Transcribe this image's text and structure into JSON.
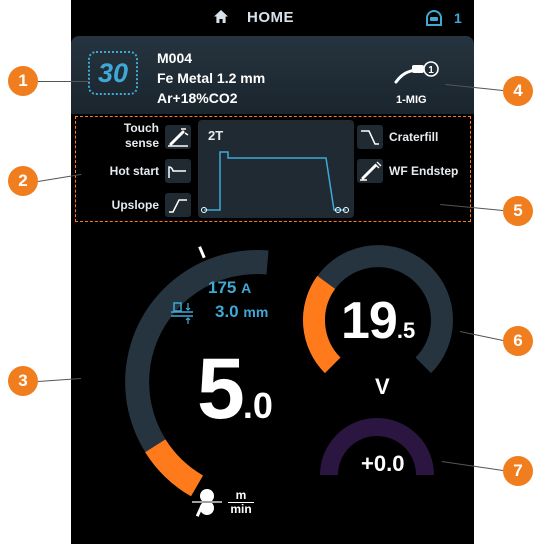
{
  "header": {
    "title": "HOME",
    "user_count": "1"
  },
  "program": {
    "memory_number": "30",
    "name": "M004",
    "wire": "Fe Metal 1.2 mm",
    "gas": "Ar+18%CO2",
    "process_label": "1-MIG",
    "process_icon_number": "1"
  },
  "settings": {
    "touch_sense": "Touch sense",
    "touch_sense_line1": "Touch",
    "touch_sense_line2": "sense",
    "hot_start": "Hot start",
    "upslope": "Upslope",
    "trigger_mode": "2T",
    "craterfill": "Craterfill",
    "wf_endstep": "WF Endstep"
  },
  "wire_feed": {
    "value_main": "5",
    "value_decimal": ".0",
    "level_fraction": 0.18,
    "unit_top": "m",
    "unit_bottom": "min",
    "current_value": "175",
    "current_unit": "A",
    "thickness_value": "3.0",
    "thickness_unit": "mm"
  },
  "voltage": {
    "value_main": "19",
    "value_decimal": ".5",
    "unit": "V",
    "level_fraction": 0.3
  },
  "fine_tune": {
    "value": "+0.0"
  },
  "callouts": [
    "1",
    "2",
    "3",
    "4",
    "5",
    "6",
    "7"
  ],
  "colors": {
    "accent_blue": "#3fa9d6",
    "accent_orange": "#ff7a1a",
    "gauge_track": "#26343f",
    "fine_tune_track": "#2a1640",
    "callout": "#f07d1e"
  }
}
